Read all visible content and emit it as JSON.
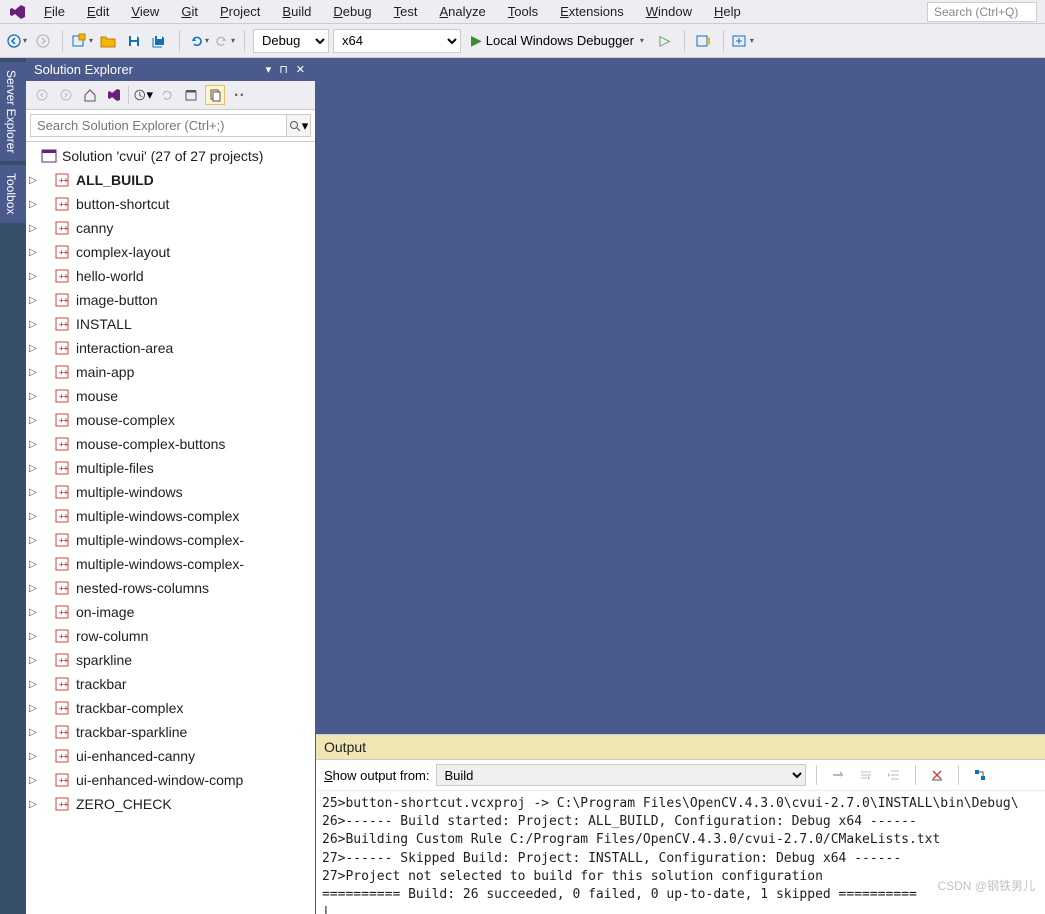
{
  "menubar": {
    "items": [
      "File",
      "Edit",
      "View",
      "Git",
      "Project",
      "Build",
      "Debug",
      "Test",
      "Analyze",
      "Tools",
      "Extensions",
      "Window",
      "Help"
    ],
    "search_placeholder": "Search (Ctrl+Q)"
  },
  "toolbar": {
    "config": "Debug",
    "platform": "x64",
    "debugger_label": "Local Windows Debugger"
  },
  "left_tabs": [
    "Server Explorer",
    "Toolbox"
  ],
  "solution_explorer": {
    "title": "Solution Explorer",
    "search_placeholder": "Search Solution Explorer (Ctrl+;)",
    "solution_label": "Solution 'cvui' (27 of 27 projects)",
    "projects": [
      {
        "name": "ALL_BUILD",
        "bold": true
      },
      {
        "name": "button-shortcut"
      },
      {
        "name": "canny"
      },
      {
        "name": "complex-layout"
      },
      {
        "name": "hello-world"
      },
      {
        "name": "image-button"
      },
      {
        "name": "INSTALL"
      },
      {
        "name": "interaction-area"
      },
      {
        "name": "main-app"
      },
      {
        "name": "mouse"
      },
      {
        "name": "mouse-complex"
      },
      {
        "name": "mouse-complex-buttons"
      },
      {
        "name": "multiple-files"
      },
      {
        "name": "multiple-windows"
      },
      {
        "name": "multiple-windows-complex"
      },
      {
        "name": "multiple-windows-complex-"
      },
      {
        "name": "multiple-windows-complex-"
      },
      {
        "name": "nested-rows-columns"
      },
      {
        "name": "on-image"
      },
      {
        "name": "row-column"
      },
      {
        "name": "sparkline"
      },
      {
        "name": "trackbar"
      },
      {
        "name": "trackbar-complex"
      },
      {
        "name": "trackbar-sparkline"
      },
      {
        "name": "ui-enhanced-canny"
      },
      {
        "name": "ui-enhanced-window-comp"
      },
      {
        "name": "ZERO_CHECK"
      }
    ]
  },
  "output": {
    "title": "Output",
    "show_from_label": "Show output from:",
    "show_from_value": "Build",
    "lines": [
      "25>button-shortcut.vcxproj -> C:\\Program Files\\OpenCV.4.3.0\\cvui-2.7.0\\INSTALL\\bin\\Debug\\",
      "26>------ Build started: Project: ALL_BUILD, Configuration: Debug x64 ------",
      "26>Building Custom Rule C:/Program Files/OpenCV.4.3.0/cvui-2.7.0/CMakeLists.txt",
      "27>------ Skipped Build: Project: INSTALL, Configuration: Debug x64 ------",
      "27>Project not selected to build for this solution configuration",
      "========== Build: 26 succeeded, 0 failed, 0 up-to-date, 1 skipped =========="
    ]
  },
  "watermark": "CSDN @钢铁男儿"
}
